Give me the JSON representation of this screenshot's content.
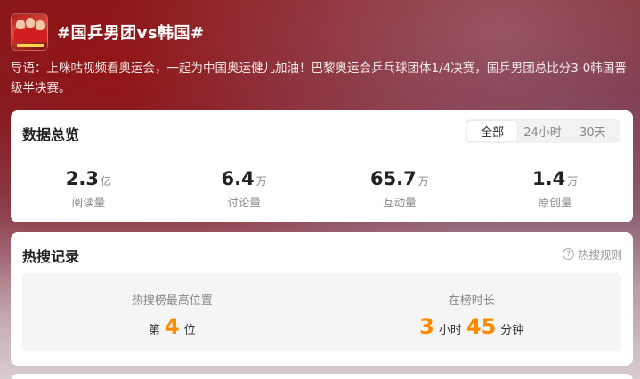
{
  "header": {
    "title": "#国乒男团vs韩国#",
    "avatar_icon": "team-photo-icon"
  },
  "intro": "导语：上咪咕视频看奥运会，一起为中国奥运健儿加油！巴黎奥运会乒乓球团体1/4决赛，国乒男团总比分3-0韩国晋级半决赛。",
  "overview": {
    "title": "数据总览",
    "tabs": [
      {
        "label": "全部",
        "active": true
      },
      {
        "label": "24小时",
        "active": false
      },
      {
        "label": "30天",
        "active": false
      }
    ],
    "stats": [
      {
        "value": "2.3",
        "unit": "亿",
        "label": "阅读量"
      },
      {
        "value": "6.4",
        "unit": "万",
        "label": "讨论量"
      },
      {
        "value": "65.7",
        "unit": "万",
        "label": "互动量"
      },
      {
        "value": "1.4",
        "unit": "万",
        "label": "原创量"
      }
    ]
  },
  "hot": {
    "title": "热搜记录",
    "rule_label": "热搜规则",
    "rule_icon": "question-circle-icon",
    "peak": {
      "label": "热搜榜最高位置",
      "prefix": "第",
      "value": "4",
      "suffix": "位"
    },
    "duration": {
      "label": "在榜时长",
      "hours": "3",
      "hours_unit": "小时",
      "minutes": "45",
      "minutes_unit": "分钟"
    }
  },
  "colors": {
    "accent": "#ff8a00",
    "card_bg": "#ffffff",
    "panel_bg": "#f5f5f5"
  }
}
